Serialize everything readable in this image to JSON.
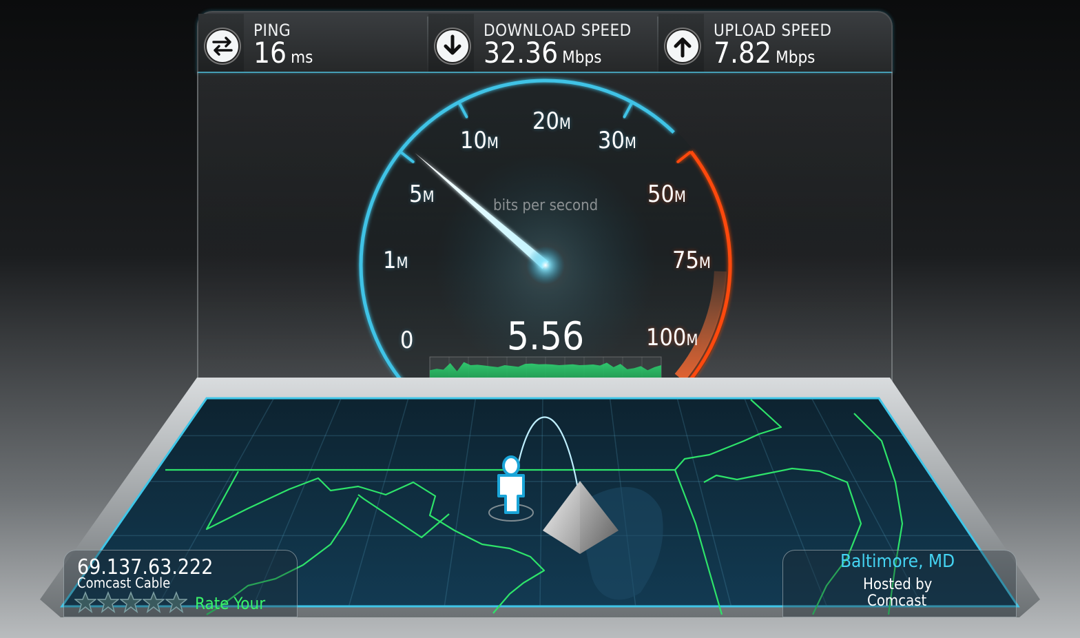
{
  "stats": {
    "ping": {
      "label": "PING",
      "value": "16",
      "unit": "ms",
      "icon": "ping-arrows-icon"
    },
    "download": {
      "label": "DOWNLOAD SPEED",
      "value": "32.36",
      "unit": "Mbps",
      "icon": "download-arrow-icon"
    },
    "upload": {
      "label": "UPLOAD SPEED",
      "value": "7.82",
      "unit": "Mbps",
      "icon": "upload-arrow-icon"
    }
  },
  "gauge": {
    "scale_labels": {
      "l0": "0",
      "l1": "1",
      "l5": "5",
      "l10": "10",
      "l20": "20",
      "l30": "30",
      "l50": "50",
      "l75": "75",
      "l100": "100"
    },
    "unit_suffix": "M",
    "caption": "bits per second",
    "current_value": "5.56",
    "current_value_mbps": 5.56,
    "colors": {
      "normal": "#3fc3e6",
      "hot": "#ff4a10",
      "needle": "#ffffff"
    }
  },
  "graph": {
    "samples": [
      0.55,
      0.62,
      0.58,
      0.9,
      0.5,
      0.95,
      0.8,
      0.82,
      0.78,
      0.74,
      0.7,
      0.8,
      0.76,
      0.72,
      0.86,
      0.88,
      0.84,
      0.85,
      0.83,
      0.8,
      0.82,
      0.84,
      0.8,
      0.81,
      0.83,
      0.78,
      0.92,
      0.7,
      0.86,
      0.6,
      0.65,
      0.75,
      0.55,
      0.7,
      0.8
    ],
    "color": "#2ecb6e"
  },
  "client": {
    "ip": "69.137.63.222",
    "isp": "Comcast Cable",
    "rating_stars": 5,
    "rate_label": "Rate Your"
  },
  "server": {
    "city": "Baltimore, MD",
    "hosted_by_label": "Hosted by",
    "host": "Comcast"
  }
}
